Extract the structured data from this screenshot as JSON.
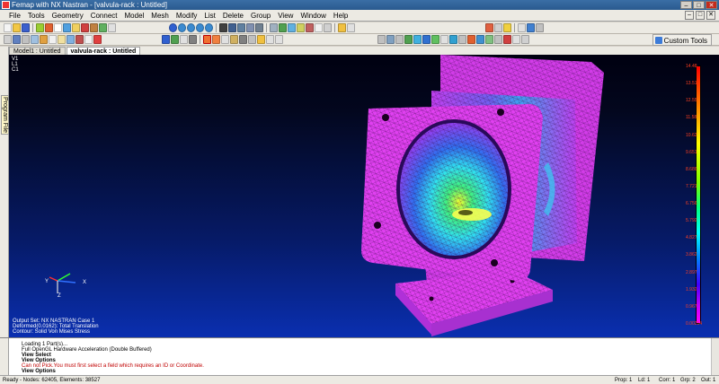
{
  "window": {
    "title": "Femap with NX Nastran - [valvula-rack : Untitled]"
  },
  "menu": [
    "File",
    "Tools",
    "Geometry",
    "Connect",
    "Model",
    "Mesh",
    "Modify",
    "List",
    "Delete",
    "Group",
    "View",
    "Window",
    "Help"
  ],
  "toolbar": {
    "custom_tools_label": "Custom Tools"
  },
  "side_panel": {
    "label": "Program File"
  },
  "doc_tabs": [
    {
      "label": "Model1 : Untitled"
    },
    {
      "label": "valvula-rack : Untitled"
    }
  ],
  "viewport": {
    "view_labels": [
      "V1",
      "L1",
      "C1"
    ],
    "axis_labels": {
      "x": "X",
      "y": "Y",
      "z": "Z"
    },
    "status_lines": [
      "Output Set: NX NASTRAN Case 1",
      "Deformed(0.0162): Total Translation",
      "Contour: Solid Von Mises Stress"
    ],
    "legend_values": [
      "14.48",
      "13.51",
      "12.55",
      "11.58",
      "10.62",
      "9.651",
      "8.686",
      "7.721",
      "6.756",
      "5.792",
      "4.827",
      "3.862",
      "2.897",
      "1.932",
      "0.967",
      "0.00214"
    ],
    "colors": {
      "mesh_magenta": "#e03cf0",
      "mesh_edge": "#2a0a3a",
      "hot_yellow": "#f0ff30",
      "cool_green": "#40f080",
      "cyan": "#30e0f0",
      "blue": "#3070f0"
    }
  },
  "messages": [
    {
      "text": "Loading 1 Part(s)...",
      "style": "normal"
    },
    {
      "text": "Full OpenGL Hardware Acceleration (Double Buffered)",
      "style": "normal"
    },
    {
      "text": "View Select",
      "style": "bold"
    },
    {
      "text": "View Options",
      "style": "bold"
    },
    {
      "text": "Can not Pick.You must first select a field which requires an ID or Coordinate.",
      "style": "err"
    },
    {
      "text": "View Options",
      "style": "bold"
    }
  ],
  "statusbar": {
    "left": "Ready - Nodes: 62405,  Elements: 38527",
    "prop": "Prop: 1",
    "ld": "Ld: 1",
    "csys": "Corr: 1",
    "grp": "Grp: 2",
    "out": "Out: 1"
  }
}
